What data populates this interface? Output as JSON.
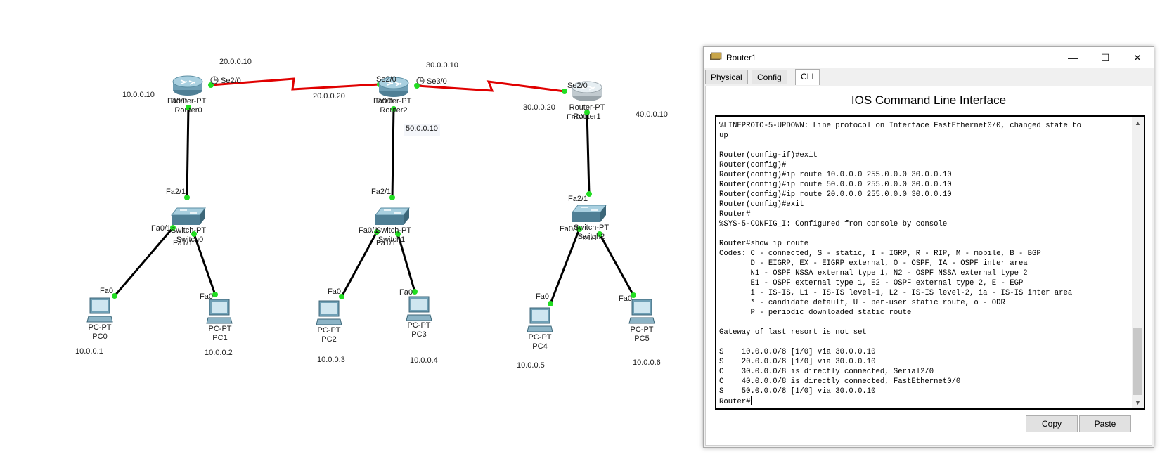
{
  "topology": {
    "links": {
      "serial_r0_r2": "Se2/0",
      "serial_r2_r0": "Se2/0",
      "serial_r2_r1": "Se3/0",
      "serial_r1_r2": "Se2/0",
      "r0_fa": "Fa0/0",
      "r2_fa": "Fa0/0",
      "r1_fa": "Fa0/0",
      "sw0_up": "Fa2/1",
      "sw2_up": "Fa2/1",
      "sw1_up": "Fa2/1",
      "sw_left_port": "Fa0/1",
      "sw_right_port": "Fa1/1",
      "pc_port": "Fa0"
    },
    "routers": [
      {
        "type": "Router-PT",
        "name": "Router0"
      },
      {
        "type": "Router-PT",
        "name": "Router2"
      },
      {
        "type": "Router-PT",
        "name": "Router1"
      }
    ],
    "switches": [
      {
        "type": "Switch-PT",
        "name": "Switch0"
      },
      {
        "type": "Switch-PT",
        "name": "Switch1"
      },
      {
        "type": "Switch-PT",
        "name": "Switch2"
      }
    ],
    "pcs": [
      {
        "type": "PC-PT",
        "name": "PC0",
        "ip": "10.0.0.1"
      },
      {
        "type": "PC-PT",
        "name": "PC1",
        "ip": "10.0.0.2"
      },
      {
        "type": "PC-PT",
        "name": "PC2",
        "ip": "10.0.0.3"
      },
      {
        "type": "PC-PT",
        "name": "PC3",
        "ip": "10.0.0.4"
      },
      {
        "type": "PC-PT",
        "name": "PC4",
        "ip": "10.0.0.5"
      },
      {
        "type": "PC-PT",
        "name": "PC5",
        "ip": "10.0.0.6"
      }
    ],
    "notes": {
      "n1": "20.0.0.10",
      "n2": "10.0.0.10",
      "n3": "20.0.0.20",
      "n4": "30.0.0.10",
      "n5": "50.0.0.10",
      "n6": "30.0.0.20",
      "n7": "40.0.0.10"
    },
    "colors": {
      "serial_link": "#e00000",
      "ethernet_link": "#000000",
      "port_light": "#22dd22"
    }
  },
  "window": {
    "title": "Router1",
    "controls": {
      "minimize": "—",
      "maximize": "☐",
      "close": "✕"
    },
    "tabs": [
      "Physical",
      "Config",
      "CLI"
    ],
    "active_tab": "CLI",
    "cli_heading": "IOS Command Line Interface",
    "console_text": "%LINEPROTO-5-UPDOWN: Line protocol on Interface FastEthernet0/0, changed state to\nup\n\nRouter(config-if)#exit\nRouter(config)#\nRouter(config)#ip route 10.0.0.0 255.0.0.0 30.0.0.10\nRouter(config)#ip route 50.0.0.0 255.0.0.0 30.0.0.10\nRouter(config)#ip route 20.0.0.0 255.0.0.0 30.0.0.10\nRouter(config)#exit\nRouter#\n%SYS-5-CONFIG_I: Configured from console by console\n\nRouter#show ip route\nCodes: C - connected, S - static, I - IGRP, R - RIP, M - mobile, B - BGP\n       D - EIGRP, EX - EIGRP external, O - OSPF, IA - OSPF inter area\n       N1 - OSPF NSSA external type 1, N2 - OSPF NSSA external type 2\n       E1 - OSPF external type 1, E2 - OSPF external type 2, E - EGP\n       i - IS-IS, L1 - IS-IS level-1, L2 - IS-IS level-2, ia - IS-IS inter area\n       * - candidate default, U - per-user static route, o - ODR\n       P - periodic downloaded static route\n\nGateway of last resort is not set\n\nS    10.0.0.0/8 [1/0] via 30.0.0.10\nS    20.0.0.0/8 [1/0] via 30.0.0.10\nC    30.0.0.0/8 is directly connected, Serial2/0\nC    40.0.0.0/8 is directly connected, FastEthernet0/0\nS    50.0.0.0/8 [1/0] via 30.0.0.10\nRouter#",
    "buttons": {
      "copy": "Copy",
      "paste": "Paste"
    }
  }
}
